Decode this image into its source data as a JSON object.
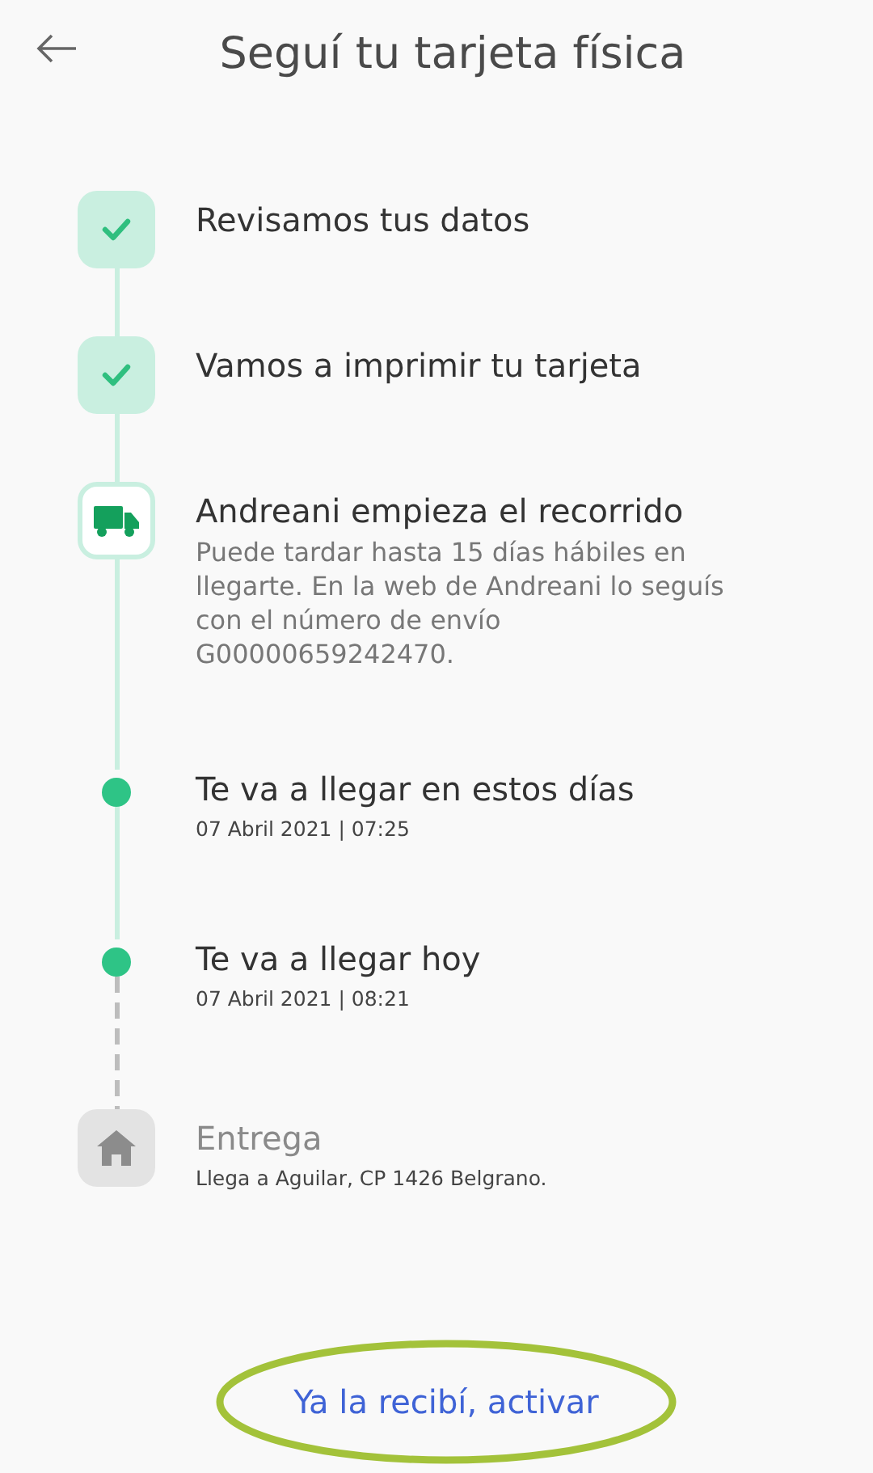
{
  "header": {
    "title": "Seguí tu tarjeta física"
  },
  "steps": [
    {
      "kind": "done",
      "title": "Revisamos tus datos"
    },
    {
      "kind": "done",
      "title": "Vamos a imprimir tu tarjeta"
    },
    {
      "kind": "current",
      "title": "Andreani empieza el recorrido",
      "description": "Puede tardar hasta 15 días hábiles en llegarte. En la web de Andreani lo seguís con el número de envío G00000659242470."
    },
    {
      "kind": "dot",
      "title": "Te va a llegar en estos días",
      "date": "07 Abril 2021 | 07:25"
    },
    {
      "kind": "dot",
      "title": "Te va a llegar hoy",
      "date": "07 Abril 2021 | 08:21"
    },
    {
      "kind": "pending",
      "title": "Entrega",
      "date": "Llega a Aguilar, CP 1426 Belgrano."
    }
  ],
  "action": {
    "label": "Ya la recibí, activar"
  }
}
